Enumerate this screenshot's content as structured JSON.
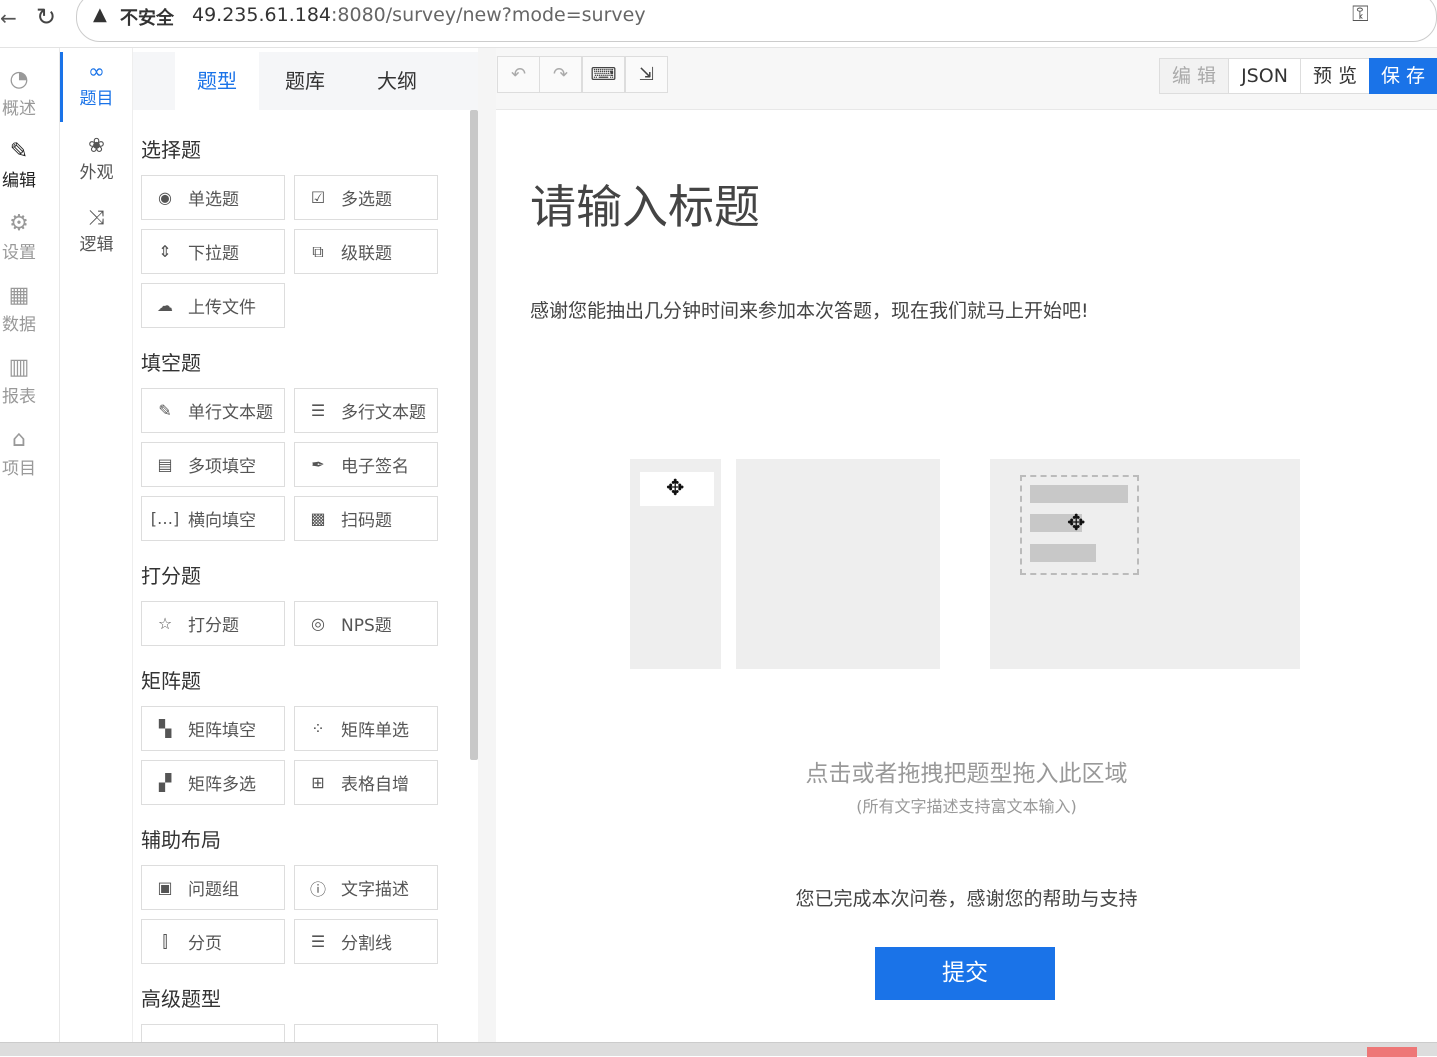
{
  "browser": {
    "security_label": "不安全",
    "url_host": "49.235.61.184",
    "url_rest": ":8080/survey/new?mode=survey"
  },
  "nav_primary": [
    {
      "label": "概述",
      "icon": "dashboard-icon"
    },
    {
      "label": "编辑",
      "icon": "pencil-icon"
    },
    {
      "label": "设置",
      "icon": "gear-icon"
    },
    {
      "label": "数据",
      "icon": "table-icon"
    },
    {
      "label": "报表",
      "icon": "bar-chart-icon"
    },
    {
      "label": "项目",
      "icon": "home-icon"
    }
  ],
  "nav_secondary": [
    {
      "label": "题目",
      "icon": "circles-icon"
    },
    {
      "label": "外观",
      "icon": "palette-icon"
    },
    {
      "label": "逻辑",
      "icon": "shuffle-icon"
    }
  ],
  "panel": {
    "tabs": [
      "题型",
      "题库",
      "大纲"
    ],
    "sections": [
      {
        "title": "选择题",
        "items": [
          {
            "label": "单选题",
            "icon": "radio-icon"
          },
          {
            "label": "多选题",
            "icon": "checkbox-icon"
          },
          {
            "label": "下拉题",
            "icon": "dropdown-icon"
          },
          {
            "label": "级联题",
            "icon": "cascade-icon"
          },
          {
            "label": "上传文件",
            "icon": "upload-icon"
          }
        ]
      },
      {
        "title": "填空题",
        "items": [
          {
            "label": "单行文本题",
            "icon": "edit-icon"
          },
          {
            "label": "多行文本题",
            "icon": "multiline-icon"
          },
          {
            "label": "多项填空",
            "icon": "multi-fill-icon"
          },
          {
            "label": "电子签名",
            "icon": "signature-icon"
          },
          {
            "label": "横向填空",
            "icon": "bracket-icon"
          },
          {
            "label": "扫码题",
            "icon": "qrcode-icon"
          }
        ]
      },
      {
        "title": "打分题",
        "items": [
          {
            "label": "打分题",
            "icon": "star-icon"
          },
          {
            "label": "NPS题",
            "icon": "nps-icon"
          }
        ]
      },
      {
        "title": "矩阵题",
        "items": [
          {
            "label": "矩阵填空",
            "icon": "matrix-fill-icon"
          },
          {
            "label": "矩阵单选",
            "icon": "matrix-radio-icon"
          },
          {
            "label": "矩阵多选",
            "icon": "matrix-check-icon"
          },
          {
            "label": "表格自增",
            "icon": "table-add-icon"
          }
        ]
      },
      {
        "title": "辅助布局",
        "items": [
          {
            "label": "问题组",
            "icon": "group-icon"
          },
          {
            "label": "文字描述",
            "icon": "info-icon"
          },
          {
            "label": "分页",
            "icon": "page-break-icon"
          },
          {
            "label": "分割线",
            "icon": "divider-icon"
          }
        ]
      },
      {
        "title": "高级题型",
        "items": []
      }
    ]
  },
  "toolbar": {
    "undo_icon": "undo-icon",
    "redo_icon": "redo-icon",
    "keyboard_icon": "keyboard-icon",
    "shortcut_icon": "jump-icon",
    "edit_label": "编 辑",
    "json_label": "JSON",
    "preview_label": "预 览",
    "save_label": "保 存"
  },
  "survey": {
    "title": "请输入标题",
    "description": "感谢您能抽出几分钟时间来参加本次答题，现在我们就马上开始吧!",
    "drop_hint": "点击或者拖拽把题型拖入此区域",
    "drop_sub": "(所有文字描述支持富文本输入)",
    "end_text": "您已完成本次问卷，感谢您的帮助与支持",
    "submit_label": "提交"
  },
  "colors": {
    "accent": "#1a73e8"
  }
}
